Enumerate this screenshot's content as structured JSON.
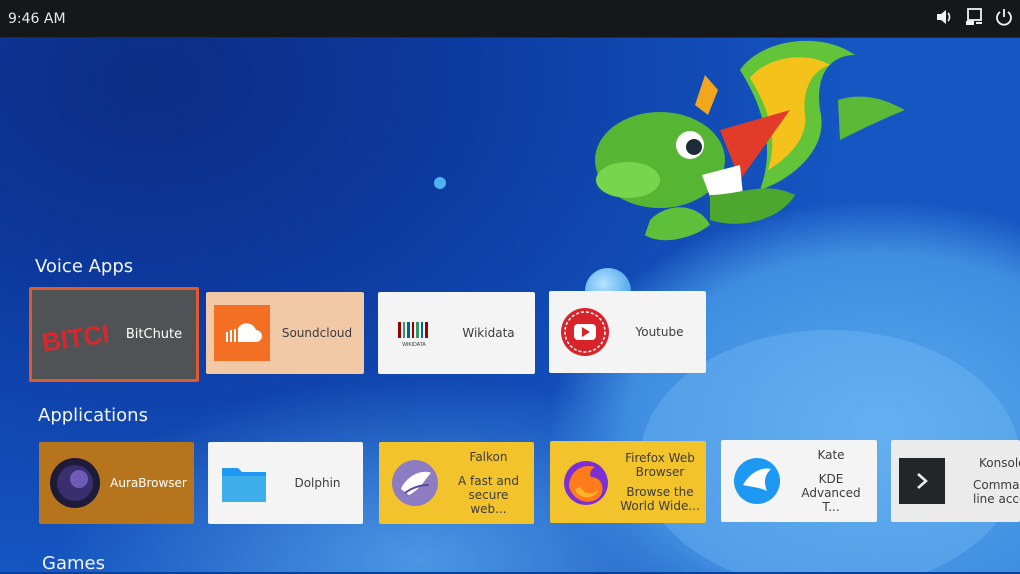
{
  "status_bar": {
    "time": "9:46 AM",
    "icons": [
      "speaker-icon",
      "network-icon",
      "power-icon"
    ]
  },
  "sections": {
    "voice_apps": {
      "title": "Voice Apps",
      "items": [
        {
          "label": "BitChute",
          "logo_text": "BITCHUTE",
          "icon": "bitchute-icon",
          "selected": true
        },
        {
          "label": "Soundcloud",
          "icon": "soundcloud-icon"
        },
        {
          "label": "Wikidata",
          "logo_text": "WIKIDATA",
          "icon": "wikidata-icon"
        },
        {
          "label": "Youtube",
          "icon": "youtube-icon"
        }
      ]
    },
    "applications": {
      "title": "Applications",
      "items": [
        {
          "label": "AuraBrowser",
          "icon": "aurabrowser-icon"
        },
        {
          "label": "Dolphin",
          "icon": "dolphin-folder-icon"
        },
        {
          "label": "Falkon",
          "desc": "A fast and secure web...",
          "icon": "falkon-icon"
        },
        {
          "label": "Firefox Web Browser",
          "desc": "Browse the World Wide...",
          "icon": "firefox-icon"
        },
        {
          "label": "Kate",
          "desc": "KDE Advanced T...",
          "icon": "kate-icon"
        },
        {
          "label": "Konsole",
          "desc": "Command line acce",
          "icon": "konsole-icon"
        }
      ]
    },
    "games": {
      "title": "Games"
    }
  },
  "colors": {
    "topbar": "#151719",
    "selected_border": "#e05a2c",
    "aurabrowser_bg": "#b6741c",
    "yellow_card": "#f3c32c",
    "soundcloud_card": "#f1c9a6"
  }
}
